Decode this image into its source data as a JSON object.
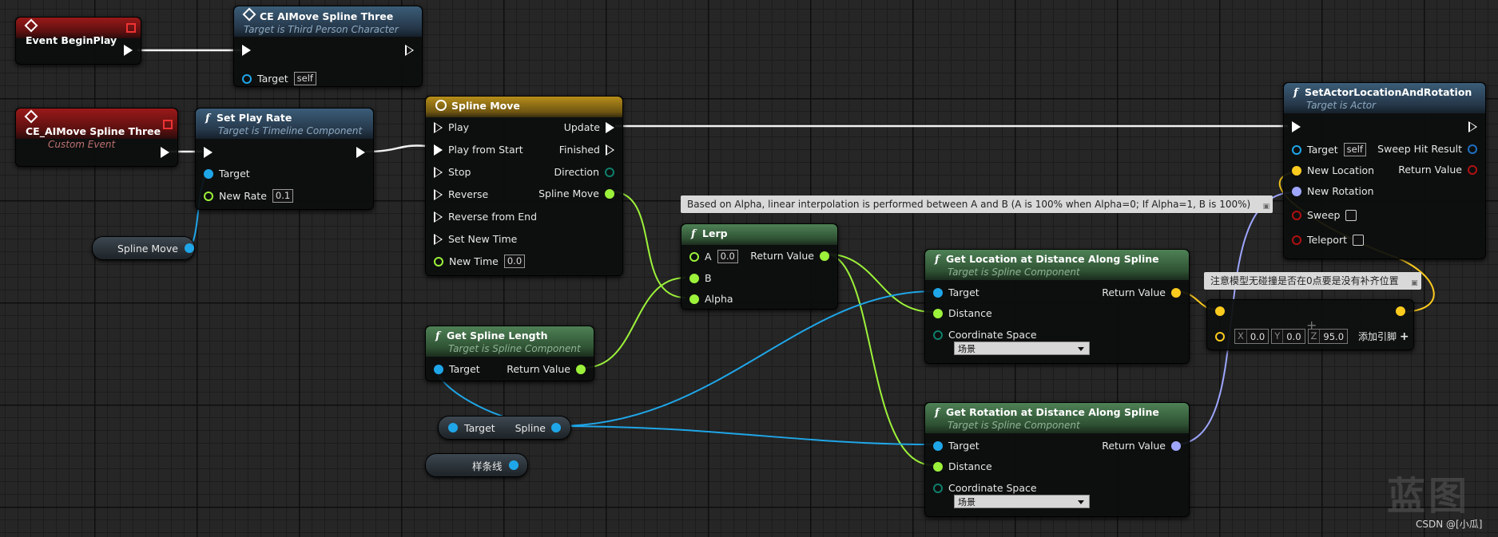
{
  "nodes": {
    "event_begin_play": {
      "title": "Event BeginPlay"
    },
    "ce_aimove_call": {
      "title": "CE AIMove Spline Three",
      "subtitle": "Target is Third Person Character",
      "target_label": "Target",
      "target_value": "self"
    },
    "custom_event": {
      "title": "CE_AIMove Spline Three",
      "subtitle": "Custom Event"
    },
    "set_play_rate": {
      "title": "Set Play Rate",
      "subtitle": "Target is Timeline Component",
      "target_label": "Target",
      "new_rate_label": "New Rate",
      "new_rate_value": "0.1"
    },
    "spline_move_timeline": {
      "title": "Spline Move",
      "inputs": [
        "Play",
        "Play from Start",
        "Stop",
        "Reverse",
        "Reverse from End",
        "Set New Time"
      ],
      "new_time_label": "New Time",
      "new_time_value": "0.0",
      "outputs": [
        "Update",
        "Finished",
        "Direction",
        "Spline Move"
      ]
    },
    "lerp": {
      "title": "Lerp",
      "a_label": "A",
      "a_value": "0.0",
      "b_label": "B",
      "alpha_label": "Alpha",
      "return_label": "Return Value"
    },
    "get_spline_length": {
      "title": "Get Spline Length",
      "subtitle": "Target is Spline Component",
      "target_label": "Target",
      "return_label": "Return Value"
    },
    "get_location": {
      "title": "Get Location at Distance Along Spline",
      "subtitle": "Target is Spline Component",
      "target_label": "Target",
      "distance_label": "Distance",
      "coord_label": "Coordinate Space",
      "coord_value": "场景",
      "return_label": "Return Value"
    },
    "get_rotation": {
      "title": "Get Rotation at Distance Along Spline",
      "subtitle": "Target is Spline Component",
      "target_label": "Target",
      "distance_label": "Distance",
      "coord_label": "Coordinate Space",
      "coord_value": "场景",
      "return_label": "Return Value"
    },
    "set_actor_loc_rot": {
      "title": "SetActorLocationAndRotation",
      "subtitle": "Target is Actor",
      "target_label": "Target",
      "target_value": "self",
      "new_location_label": "New Location",
      "new_rotation_label": "New Rotation",
      "sweep_label": "Sweep",
      "teleport_label": "Teleport",
      "sweep_hit_label": "Sweep Hit Result",
      "return_label": "Return Value"
    },
    "add_vector": {
      "x_label": "X",
      "x_value": "0.0",
      "y_label": "Y",
      "y_value": "0.0",
      "z_label": "Z",
      "z_value": "95.0",
      "add_pin_label": "添加引脚"
    }
  },
  "variables": {
    "spline_move_var": "Spline Move",
    "spline_get": {
      "target_label": "Target",
      "output_label": "Spline"
    },
    "spline_var_cn": "样条线"
  },
  "comments": {
    "lerp_comment": "Based on Alpha, linear interpolation is performed between A and B (A is 100% when Alpha=0; If Alpha=1, B is 100%)",
    "add_comment": "注意模型无碰撞是否在0点要是没有补齐位置"
  },
  "watermark": "蓝图",
  "credit": "CSDN @[小瓜]",
  "colors": {
    "exec": "#ffffff",
    "float": "#9cf13a",
    "object": "#1fa6e8",
    "vector": "#fccb1e",
    "rotator": "#9ea6ff",
    "bool": "#950000",
    "struct": "#0a5fa8"
  }
}
